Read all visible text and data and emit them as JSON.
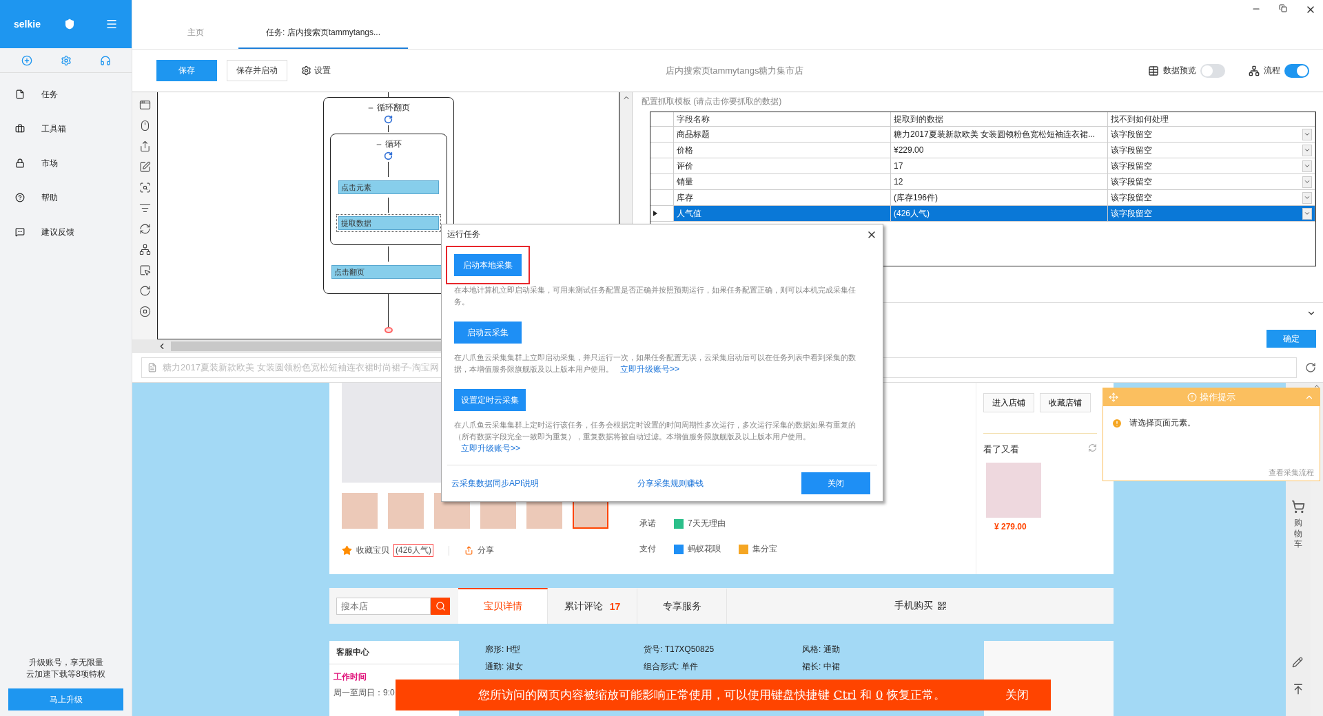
{
  "sidebar": {
    "brand": "selkie",
    "items": [
      {
        "label": "任务"
      },
      {
        "label": "工具箱"
      },
      {
        "label": "市场"
      },
      {
        "label": "帮助"
      },
      {
        "label": "建议反馈"
      }
    ],
    "promo": [
      "升级账号，享无限量",
      "云加速下载等8项特权"
    ],
    "upgrade_button": "马上升级"
  },
  "tabs": [
    {
      "label": "主页",
      "selected": false
    },
    {
      "label": "任务: 店内搜索页tammytangs...",
      "selected": true
    }
  ],
  "toolbar": {
    "save": "保存",
    "save_start": "保存并启动",
    "settings": "设置",
    "title": "店内搜索页tammytangs糖力集市店",
    "toggles": [
      {
        "label": "数据预览",
        "on": false
      },
      {
        "label": "流程",
        "on": true
      }
    ]
  },
  "flow": [
    {
      "kind": "loop",
      "label": "循环翻页",
      "children": [
        {
          "kind": "loop",
          "label": "循环",
          "children": [
            {
              "kind": "step",
              "label": "点击元素",
              "selected": false
            },
            {
              "kind": "step",
              "label": "提取数据",
              "selected": true
            }
          ]
        },
        {
          "kind": "step",
          "label": "点击翻页",
          "selected": false
        }
      ]
    }
  ],
  "template": {
    "caption": "配置抓取模板 (请点击你要抓取的数据)",
    "columns": [
      "字段名称",
      "提取到的数据",
      "找不到如何处理"
    ],
    "rows": [
      {
        "field": "商品标题",
        "data": "糖力2017夏装新款欧美 女装圆领粉色宽松短袖连衣裙...",
        "fallback": "该字段留空",
        "selected": false
      },
      {
        "field": "价格",
        "data": "¥229.00",
        "fallback": "该字段留空",
        "selected": false
      },
      {
        "field": "评价",
        "data": "17",
        "fallback": "该字段留空",
        "selected": false
      },
      {
        "field": "销量",
        "data": "12",
        "fallback": "该字段留空",
        "selected": false
      },
      {
        "field": "库存",
        "data": "(库存196件)",
        "fallback": "该字段留空",
        "selected": false
      },
      {
        "field": "人气值",
        "data": "(426人气)",
        "fallback": "该字段留空",
        "selected": true
      }
    ],
    "confirm": "确定"
  },
  "url_bar": {
    "value": "糖力2017夏装新款欧美 女装圆领粉色宽松短袖连衣裙时尚裙子-淘宝网"
  },
  "product": {
    "thumbnails": [
      {
        "selected": false
      },
      {
        "selected": false
      },
      {
        "selected": false
      },
      {
        "selected": false
      },
      {
        "selected": false
      },
      {
        "selected": true
      }
    ],
    "favorite": "收藏宝贝",
    "popularity": "(426人气)",
    "share": "分享",
    "info": [
      {
        "label": "承诺",
        "items": [
          "7天无理由"
        ]
      },
      {
        "label": "支付",
        "items": [
          "蚂蚁花呗",
          "集分宝"
        ]
      }
    ],
    "shop_buttons": [
      "进入店铺",
      "收藏店铺"
    ],
    "also_viewed": "看了又看",
    "also_price": "¥ 279.00"
  },
  "detail_tabs": {
    "search_placeholder": "搜本店",
    "tabs": [
      {
        "label": "宝贝详情",
        "selected": true
      },
      {
        "label": "累计评论",
        "count": "17",
        "selected": false
      },
      {
        "label": "专享服务",
        "selected": false
      }
    ],
    "mobile": "手机购买"
  },
  "service": {
    "title": "客服中心",
    "hours_title": "工作时间",
    "hours": "周一至周日：9:0"
  },
  "attributes": [
    "廓形: H型",
    "货号: T17XQ50825",
    "风格: 通勤",
    "通勤: 淑女",
    "组合形式: 单件",
    "裙长: 中裙"
  ],
  "side_rail": {
    "cart": "购物车"
  },
  "hint": {
    "title": "操作提示",
    "message": "请选择页面元素。",
    "link": "查看采集流程"
  },
  "notice": {
    "before": "您所访问的网页内容被缩放可能影响正常使用，可以使用键盘快捷键",
    "key1": "Ctrl",
    "mid": "和",
    "key2": "0",
    "after": "恢复正常。",
    "close": "关闭"
  },
  "dialog": {
    "title": "运行任务",
    "options": [
      {
        "button": "启动本地采集",
        "highlighted": true,
        "desc": "在本地计算机立即启动采集，可用来测试任务配置是否正确并按照预期运行，如果任务配置正确，则可以本机完成采集任务。"
      },
      {
        "button": "启动云采集",
        "highlighted": false,
        "desc": "在八爪鱼云采集集群上立即启动采集，并只运行一次，如果任务配置无误，云采集启动后可以在任务列表中看到采集的数据，本增值服务限旗舰版及以上版本用户使用。",
        "link": "立即升级账号>>"
      },
      {
        "button": "设置定时云采集",
        "highlighted": false,
        "desc": "在八爪鱼云采集集群上定时运行该任务，任务会根据定时设置的时间周期性多次运行，多次运行采集的数据如果有重复的（所有数据字段完全一致即为重复），重复数据将被自动过滤。本增值服务限旗舰版及以上版本用户使用。",
        "link": "立即升级账号>>"
      }
    ],
    "footer_links": [
      "云采集数据同步API说明",
      "分享采集规则赚钱"
    ],
    "close": "关闭"
  }
}
